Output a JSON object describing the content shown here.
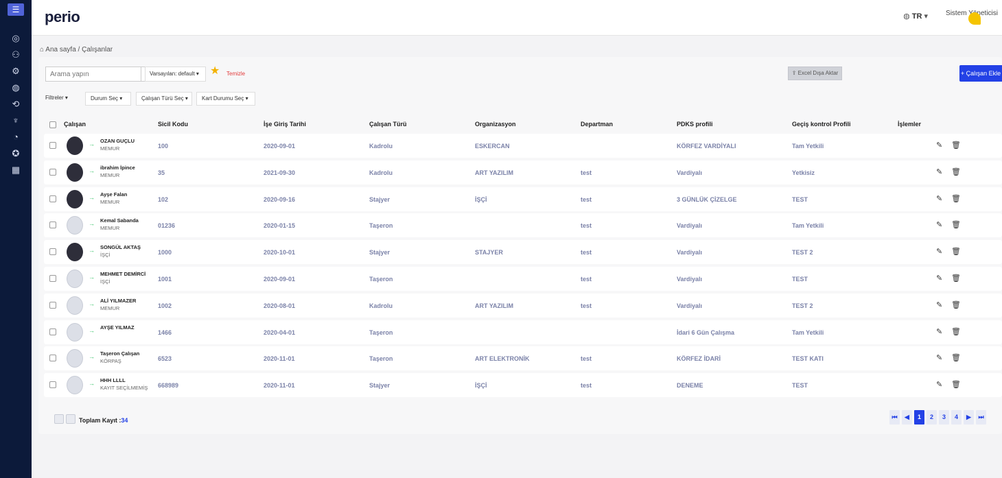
{
  "brand": {
    "name": "perio"
  },
  "header": {
    "lang": "TR",
    "user": "Sistem Yöneticisi"
  },
  "breadcrumb": {
    "home": "Ana sayfa",
    "sep": "/",
    "current": "Çalışanlar"
  },
  "sidebar": {
    "icons": [
      "menu-icon",
      "dashboard-icon",
      "people-icon",
      "org-icon",
      "device-icon",
      "report-icon",
      "food-icon",
      "chart-icon",
      "id-icon",
      "grid-icon"
    ]
  },
  "toolbar": {
    "search_placeholder": "Arama yapın",
    "saved_filter": "Varsayılan: default",
    "clear": "Temizle",
    "excel": "Excel Dışa Aktar",
    "add": "+ Çalışan Ekle"
  },
  "filters": {
    "f1": "Filtreler",
    "f2": "Durum Seç",
    "f3": "Çalışan Türü Seç",
    "f4": "Kart Durumu Seç"
  },
  "columns": [
    "Çalışan",
    "Sicil Kodu",
    "İşe Giriş Tarihi",
    "Çalışan Türü",
    "Organizasyon",
    "Departman",
    "PDKS profili",
    "Geçiş kontrol Profili",
    "İşlemler"
  ],
  "rows": [
    {
      "name": "OZAN GUÇLU",
      "role": "MEMUR",
      "code": "100",
      "date": "2020-09-01",
      "type": "Kadrolu",
      "org": "ESKERCAN",
      "dept": "",
      "pdks": "KÖRFEZ VARDİYALI",
      "access": "Tam Yetkili"
    },
    {
      "name": "ibrahim İpince",
      "role": "MEMUR",
      "code": "35",
      "date": "2021-09-30",
      "type": "Kadrolu",
      "org": "ART YAZILIM",
      "dept": "test",
      "pdks": "Vardiyalı",
      "access": "Yetkisiz"
    },
    {
      "name": "Ayşe Falan",
      "role": "MEMUR",
      "code": "102",
      "date": "2020-09-16",
      "type": "Stajyer",
      "org": "İŞÇİ",
      "dept": "test",
      "pdks": "3 GÜNLÜK ÇİZELGE",
      "access": "TEST"
    },
    {
      "name": "Kemal Sabanda",
      "role": "MEMUR",
      "code": "01236",
      "date": "2020-01-15",
      "type": "Taşeron",
      "org": "",
      "dept": "test",
      "pdks": "Vardiyalı",
      "access": "Tam Yetkili"
    },
    {
      "name": "SONGÜL AKTAŞ",
      "role": "İŞÇİ",
      "code": "1000",
      "date": "2020-10-01",
      "type": "Stajyer",
      "org": "STAJYER",
      "dept": "test",
      "pdks": "Vardiyalı",
      "access": "TEST 2"
    },
    {
      "name": "MEHMET DEMİRCİ",
      "role": "İŞÇİ",
      "code": "1001",
      "date": "2020-09-01",
      "type": "Taşeron",
      "org": "",
      "dept": "test",
      "pdks": "Vardiyalı",
      "access": "TEST"
    },
    {
      "name": "ALİ YILMAZER",
      "role": "MEMUR",
      "code": "1002",
      "date": "2020-08-01",
      "type": "Kadrolu",
      "org": "ART YAZILIM",
      "dept": "test",
      "pdks": "Vardiyalı",
      "access": "TEST 2"
    },
    {
      "name": "AYŞE YILMAZ",
      "role": "",
      "code": "1466",
      "date": "2020-04-01",
      "type": "Taşeron",
      "org": "",
      "dept": "",
      "pdks": "İdari 6 Gün Çalışma",
      "access": "Tam Yetkili"
    },
    {
      "name": "Taşeron Çalışan",
      "role": "KÖRPAŞ",
      "code": "6523",
      "date": "2020-11-01",
      "type": "Taşeron",
      "org": "ART ELEKTRONİK",
      "dept": "test",
      "pdks": "KÖRFEZ İDARİ",
      "access": "TEST KATI"
    },
    {
      "name": "HHH LLLL",
      "role": "KAYIT SEÇİLMEMİŞ",
      "code": "668989",
      "date": "2020-11-01",
      "type": "Stajyer",
      "org": "İŞÇİ",
      "dept": "test",
      "pdks": "DENEME",
      "access": "TEST"
    }
  ],
  "footer": {
    "total_label": "Toplam Kayıt :",
    "total_value": "34"
  },
  "pagination": {
    "first": "⏮",
    "prev": "◀",
    "pages": [
      "1",
      "2",
      "3",
      "4"
    ],
    "active": "1",
    "next": "▶",
    "last": "⏭"
  }
}
